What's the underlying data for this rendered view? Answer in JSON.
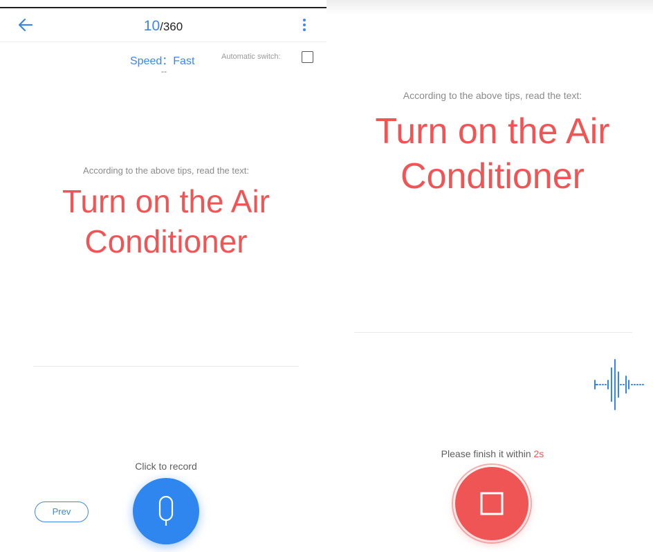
{
  "left": {
    "header": {
      "current": "10",
      "total": "/360",
      "back_icon": "arrow-left-icon",
      "more_icon": "more-vertical-icon"
    },
    "speed_label": "Speed：Fast",
    "auto_switch_label": "Automatic switch:",
    "tip_placeholder": "--",
    "instruction": "According to the above tips, read the text:",
    "phrase_line1": "Turn on the Air",
    "phrase_line2": "Conditioner",
    "record_label": "Click to record",
    "prev_label": "Prev",
    "mic_icon": "microphone-icon"
  },
  "right": {
    "instruction": "According to the above tips, read the text:",
    "phrase_line1": "Turn on the Air",
    "phrase_line2": "Conditioner",
    "finish_prefix": "Please finish it within ",
    "finish_seconds": "2s",
    "wave_icon": "audio-waveform-icon",
    "stop_icon": "stop-icon"
  },
  "colors": {
    "accent": "#3a87e6",
    "phrase": "#ef5554",
    "record_button": "#2f86ee",
    "stop_button": "#ef5554"
  }
}
